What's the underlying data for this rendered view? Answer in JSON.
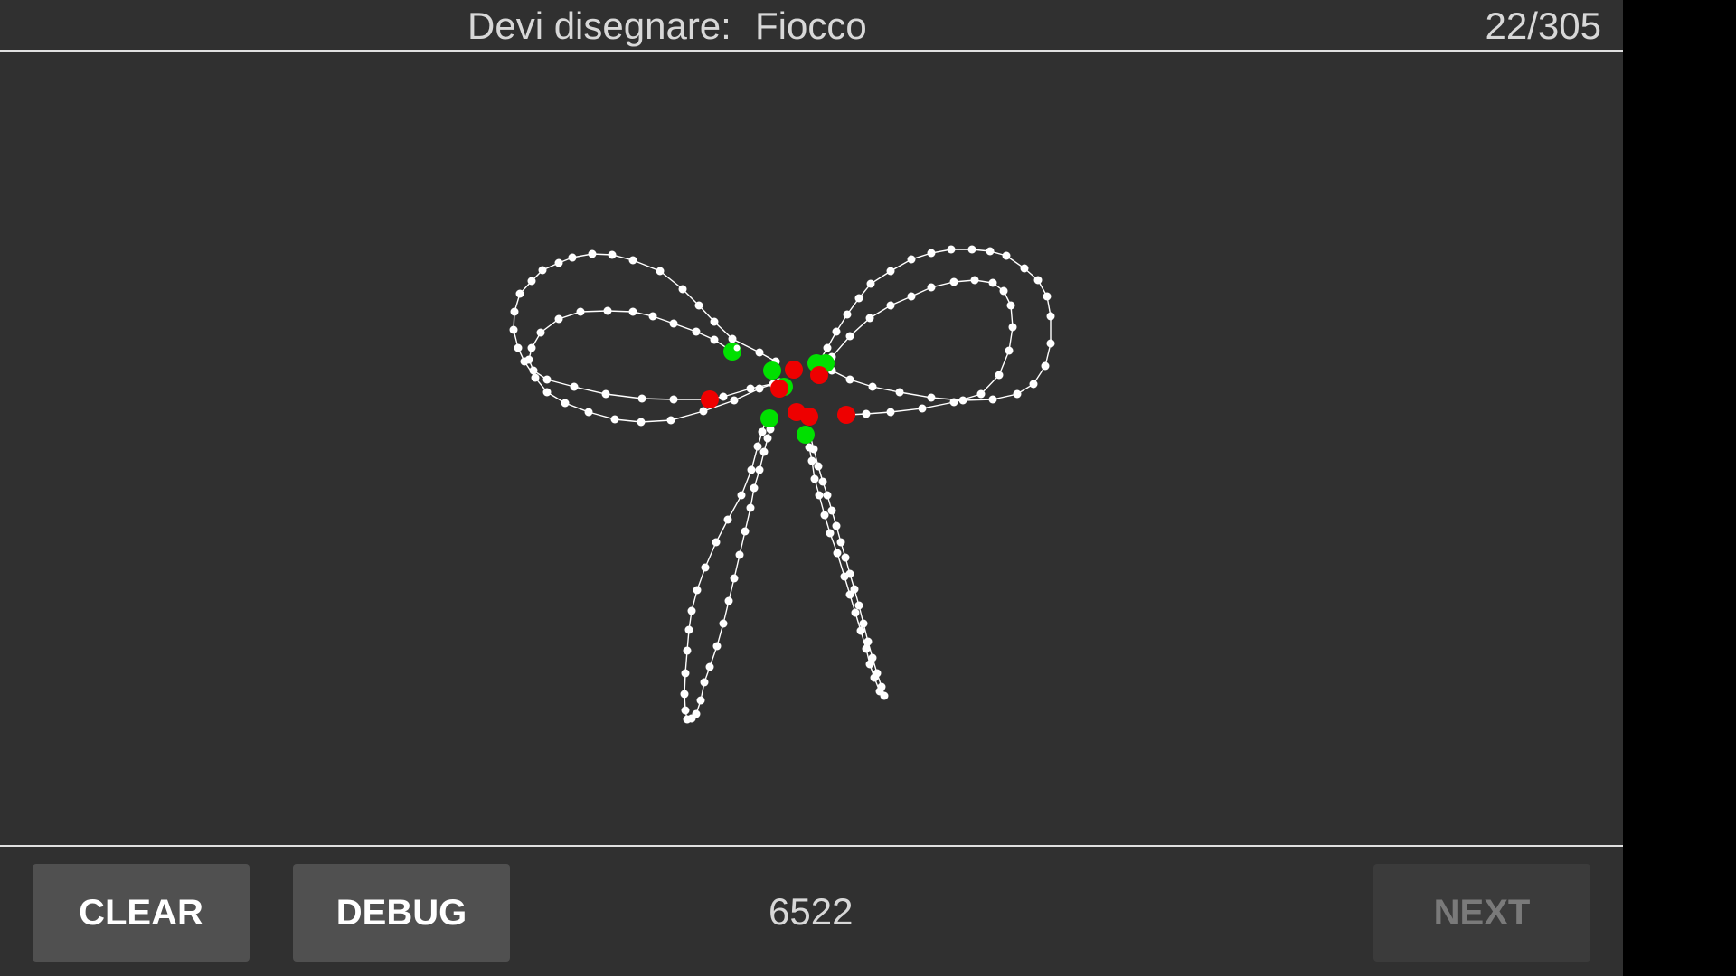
{
  "header": {
    "prompt_label": "Devi disegnare:",
    "prompt_word": "Fiocco",
    "progress": "22/305"
  },
  "footer": {
    "clear_label": "CLEAR",
    "debug_label": "DEBUG",
    "score": "6522",
    "next_label": "NEXT",
    "next_enabled": false
  },
  "colors": {
    "background": "#303030",
    "stroke": "#ffffff",
    "marker_start": "#00e000",
    "marker_end": "#ee0000"
  },
  "drawing": {
    "subject": "bow"
  }
}
